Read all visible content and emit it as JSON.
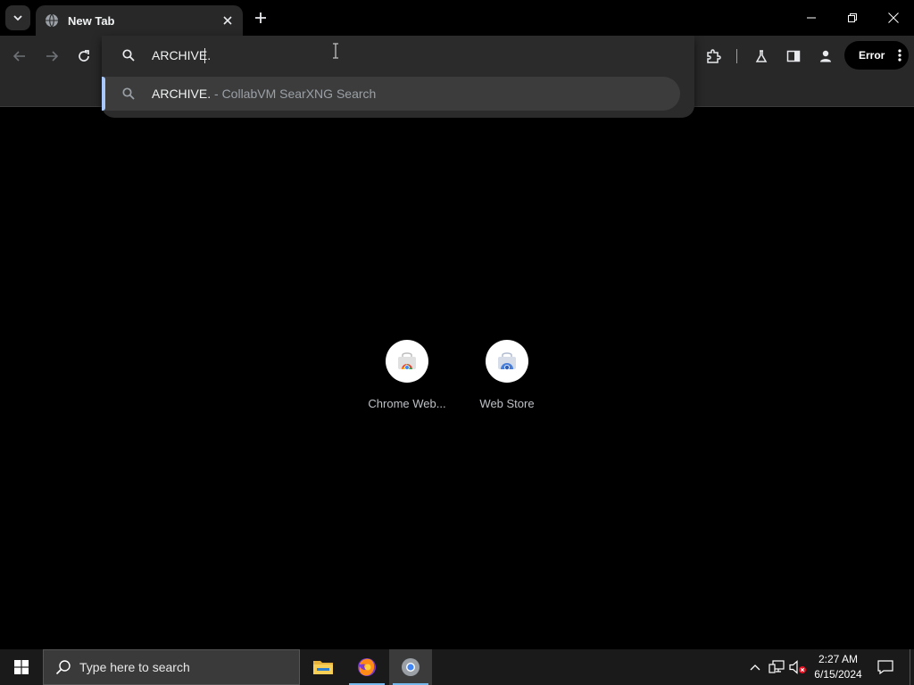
{
  "browser": {
    "tab": {
      "title": "New Tab",
      "favicon": "globe-icon"
    },
    "toolbar": {
      "profile_error_label": "Error",
      "icons": [
        "back-icon",
        "forward-icon",
        "reload-icon",
        "extensions-icon",
        "labs-icon",
        "side-panel-icon",
        "profile-icon",
        "menu-icon"
      ]
    },
    "omnibox": {
      "value": "ARCHIVE.",
      "suggestions": [
        {
          "query": "ARCHIVE.",
          "description": " - CollabVM SearXNG Search",
          "icon": "search-icon"
        }
      ]
    }
  },
  "ntp": {
    "shortcuts": [
      {
        "label": "Chrome Web...",
        "icon": "chrome-web-store-icon"
      },
      {
        "label": "Web Store",
        "icon": "web-store-icon"
      }
    ]
  },
  "taskbar": {
    "search_placeholder": "Type here to search",
    "apps": [
      "file-explorer-icon",
      "firefox-icon",
      "chrome-icon"
    ],
    "active_app": "chrome-icon",
    "clock": {
      "time": "2:27 AM",
      "date": "6/15/2024"
    }
  },
  "colors": {
    "accent": "#a8c7fa",
    "tab_bg": "#282828",
    "popup_bg": "#2b2b2b",
    "taskbar_bg": "#1a1a1a"
  }
}
